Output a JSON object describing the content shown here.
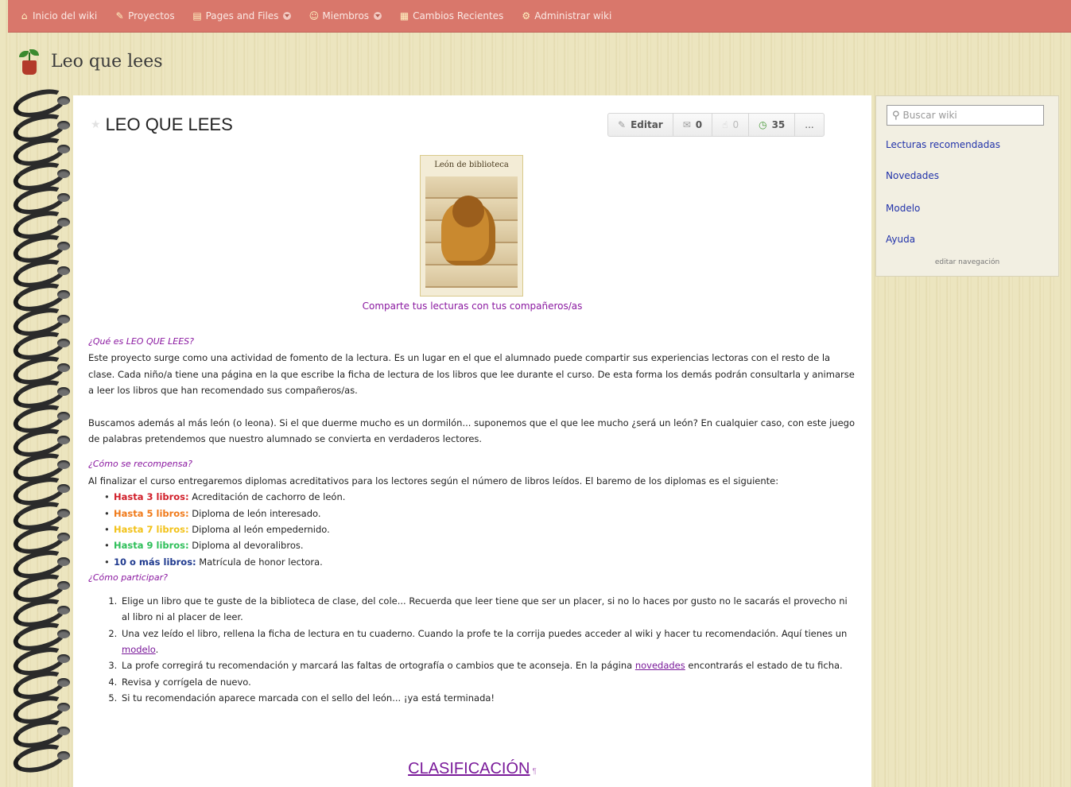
{
  "topnav": {
    "items": [
      {
        "label": "Inicio del wiki",
        "icon": "home-icon",
        "dropdown": false
      },
      {
        "label": "Proyectos",
        "icon": "projects-icon",
        "dropdown": false
      },
      {
        "label": "Pages and Files",
        "icon": "pages-icon",
        "dropdown": true
      },
      {
        "label": "Miembros",
        "icon": "members-icon",
        "dropdown": true
      },
      {
        "label": "Cambios Recientes",
        "icon": "calendar-icon",
        "dropdown": false
      },
      {
        "label": "Administrar wiki",
        "icon": "gear-icon",
        "dropdown": false
      }
    ]
  },
  "site": {
    "title": "Leo que lees",
    "logo_icon": "plant-pot-icon"
  },
  "page": {
    "title": "LEO QUE LEES",
    "actions": {
      "edit": "Editar",
      "comments": "0",
      "likes": "0",
      "views": "35",
      "more": "..."
    },
    "image_title": "León de biblioteca",
    "image_caption": "Comparte tus lecturas con tus compañeros/as",
    "h_what": "¿Qué es LEO QUE LEES?",
    "p_what_1": "Este proyecto surge como una actividad de fomento de la lectura. Es un lugar en el que el alumnado puede compartir sus experiencias lectoras con el resto de la clase. Cada niño/a tiene una página en la que escribe la ficha de lectura de los libros que lee durante el curso. De esta forma los demás podrán consultarla y animarse a leer los libros que han recomendado sus compañeros/as.",
    "p_what_2": "Buscamos además al más león (o leona). Si el que duerme mucho es un dormilón... suponemos que el que lee mucho ¿será un león? En cualquier caso, con este juego de palabras pretendemos que nuestro alumnado se convierta en verdaderos lectores.",
    "h_reward": "¿Cómo se recompensa?",
    "p_reward": "Al finalizar el curso entregaremos diplomas acreditativos para los lectores según el número de libros leídos. El baremo de los diplomas es el siguiente:",
    "levels": [
      {
        "level": "Hasta 3 libros:",
        "desc": " Acreditación de cachorro de león.",
        "color": "#d1202b"
      },
      {
        "level": "Hasta 5 libros:",
        "desc": " Diploma de león interesado.",
        "color": "#f07a1a"
      },
      {
        "level": "Hasta 7 libros:",
        "desc": " Diploma al león empedernido.",
        "color": "#f2c21a"
      },
      {
        "level": "Hasta 9 libros:",
        "desc": " Diploma al devoralibros.",
        "color": "#2fbf5a"
      },
      {
        "level": "10 o más libros:",
        "desc": " Matrícula de honor lectora.",
        "color": "#1f3a8f"
      }
    ],
    "h_participate": "¿Cómo participar?",
    "steps": [
      {
        "text": "Elige un libro que te guste de la biblioteca de clase, del cole... Recuerda que leer tiene que ser un placer, si no lo haces por gusto no le sacarás el provecho ni al libro ni al placer de leer."
      },
      {
        "text": "Una vez leído el libro, rellena la ficha de lectura en tu cuaderno. Cuando la profe te la corrija puedes acceder al wiki y hacer tu recomendación. Aquí tienes un ",
        "link": "modelo",
        "after": "."
      },
      {
        "text": "La profe corregirá tu recomendación y marcará las faltas de ortografía o cambios que te aconseja. En la página ",
        "link": "novedades",
        "after": " encontrarás el estado de tu ficha."
      },
      {
        "text": "Revisa y corrígela de nuevo."
      },
      {
        "text": "Si tu recomendación aparece marcada con el sello del león... ¡ya está terminada!"
      }
    ],
    "classification": "CLASIFICACIÓN",
    "classification_mark": "¶"
  },
  "sidebar": {
    "search_placeholder": "Buscar wiki",
    "links": [
      "Lecturas recomendadas",
      "Novedades",
      "Modelo",
      "Ayuda"
    ],
    "edit_nav": "editar navegación"
  },
  "colors": {
    "topbar": "#d9776b",
    "link": "#2233aa",
    "purple": "#8a18a0"
  }
}
